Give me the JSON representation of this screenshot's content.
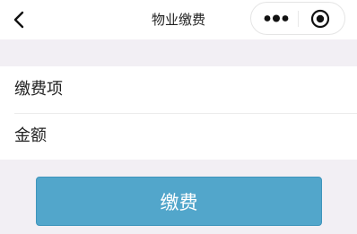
{
  "header": {
    "title": "物业缴费",
    "back_icon": "chevron-left-icon",
    "more_icon": "more-dots-icon",
    "close_icon": "target-icon"
  },
  "form": {
    "items": [
      {
        "label": "缴费项"
      },
      {
        "label": "金额"
      }
    ]
  },
  "actions": {
    "pay_label": "缴费"
  },
  "colors": {
    "background": "#f2eff4",
    "button": "#52a6cb",
    "button_border": "#3f95bc"
  }
}
